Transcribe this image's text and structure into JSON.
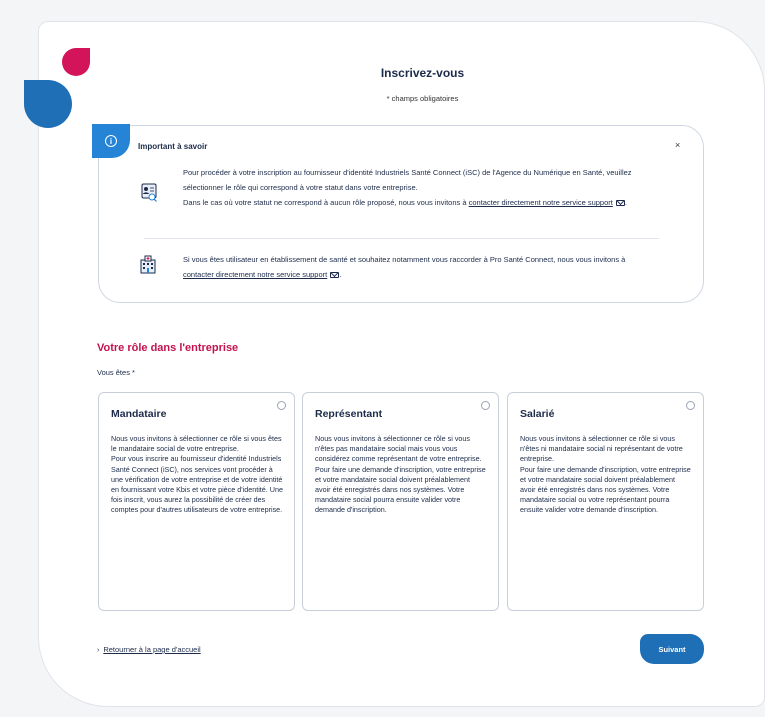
{
  "header": {
    "title": "Inscrivez-vous",
    "subtitle": "* champs obligatoires"
  },
  "info": {
    "title": "Important à savoir",
    "close": "×",
    "block1": {
      "icon": "user-id-card-icon",
      "text": "Pour procéder à votre inscription au fournisseur d'identité Industriels Santé Connect (iSC) de l'Agence du Numérique en Santé, veuillez sélectionner le rôle qui correspond à votre statut dans votre entreprise.",
      "text2": "Dans le cas où votre statut ne correspond à aucun rôle proposé, nous vous invitons à",
      "link": "contacter directement notre service support",
      "after": "."
    },
    "block2": {
      "icon": "hospital-building-icon",
      "text": "Si vous êtes utilisateur en établissement de santé et souhaitez notamment vous raccorder à Pro Santé Connect, nous vous invitons à",
      "link": "contacter directement notre service support",
      "after": "."
    }
  },
  "section": {
    "title": "Votre rôle dans l'entreprise",
    "label": "Vous êtes *"
  },
  "roles": [
    {
      "title": "Mandataire",
      "text": "Nous vous invitons à sélectionner ce rôle si vous êtes le mandataire social de votre entreprise.\nPour vous inscrire au fournisseur d'identité Industriels Santé Connect (iSC), nos services vont procéder à une vérification de votre entreprise et de votre identité en fournissant votre Kbis et votre pièce d'identité. Une fois inscrit, vous aurez la possibilité de créer des comptes pour d'autres utilisateurs de votre entreprise."
    },
    {
      "title": "Représentant",
      "text": "Nous vous invitons à sélectionner ce rôle si vous n'êtes pas mandataire social mais vous vous considérez comme représentant de votre entreprise.\nPour faire une demande d'inscription, votre entreprise et votre mandataire social doivent préalablement avoir été enregistrés dans nos systèmes. Votre mandataire social pourra ensuite valider votre demande d'inscription."
    },
    {
      "title": "Salarié",
      "text": "Nous vous invitons à sélectionner ce rôle si vous n'êtes ni mandataire social ni représentant de votre entreprise.\nPour faire une demande d'inscription, votre entreprise et votre mandataire social doivent préalablement avoir été enregistrés dans nos systèmes. Votre mandataire social ou votre représentant pourra ensuite valider votre demande d'inscription."
    }
  ],
  "footer": {
    "back": "Retourner à la page d'accueil",
    "next": "Suivant"
  },
  "colors": {
    "brand_blue": "#1f6fb6",
    "brand_red": "#d4145a",
    "section_title": "#c4124f"
  }
}
